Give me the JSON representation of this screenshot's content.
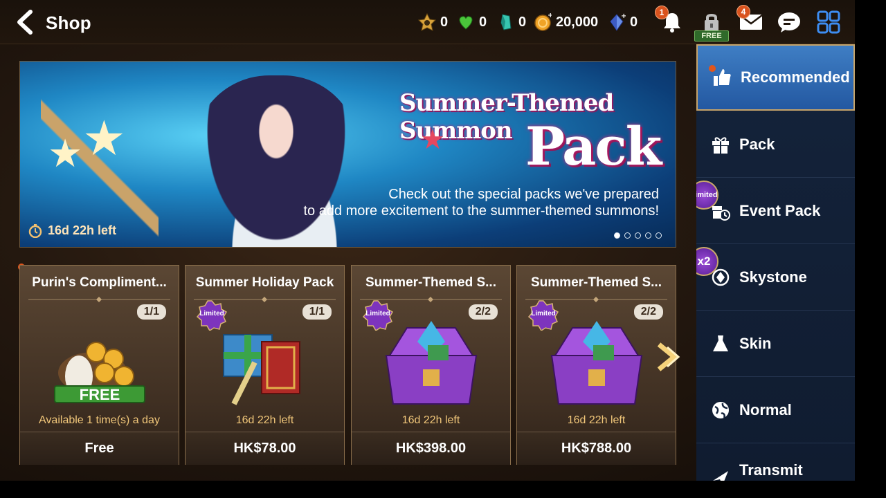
{
  "header": {
    "title": "Shop",
    "currencies": [
      {
        "icon": "mystic-medal-icon",
        "value": "0"
      },
      {
        "icon": "friendship-heart-icon",
        "value": "0"
      },
      {
        "icon": "molagora-crystal-icon",
        "value": "0"
      },
      {
        "icon": "gold-coin-icon",
        "value": "20,000"
      },
      {
        "icon": "skystone-icon",
        "value": "0"
      }
    ],
    "notification_count": "1",
    "mail_count": "4",
    "free_label": "FREE"
  },
  "banner": {
    "title_line1": "Summer-Themed Summon",
    "title_line2": "Pack",
    "description_line1": "Check out the special packs we've prepared",
    "description_line2": "to add more excitement to the summer-themed summons!",
    "timer": "16d 22h left",
    "page_index": 0,
    "page_count": 5
  },
  "cards": [
    {
      "title": "Purin's Compliment...",
      "count": "1/1",
      "limited": false,
      "free_tag": "FREE",
      "note": "Available 1 time(s) a day",
      "price": "Free",
      "has_new_dot": true
    },
    {
      "title": "Summer Holiday Pack",
      "count": "1/1",
      "limited": true,
      "note": "16d 22h left",
      "price": "HK$78.00"
    },
    {
      "title": "Summer-Themed S...",
      "count": "2/2",
      "limited": true,
      "note": "16d 22h left",
      "price": "HK$398.00"
    },
    {
      "title": "Summer-Themed S...",
      "count": "2/2",
      "limited": true,
      "note": "16d 22h left",
      "price": "HK$788.00"
    }
  ],
  "limited_label": "Limited",
  "side_menu": [
    {
      "label": "Recommended",
      "icon": "thumbs-up-icon",
      "active": true,
      "badge": ""
    },
    {
      "label": "Pack",
      "icon": "gift-icon",
      "active": false,
      "badge": ""
    },
    {
      "label": "Event Pack",
      "icon": "event-gift-icon",
      "active": false,
      "badge": "Limited"
    },
    {
      "label": "Skystone",
      "icon": "skystone-icon",
      "active": false,
      "badge": "x2"
    },
    {
      "label": "Skin",
      "icon": "dress-icon",
      "active": false,
      "badge": ""
    },
    {
      "label": "Normal",
      "icon": "globe-icon",
      "active": false,
      "badge": ""
    },
    {
      "label": "Transmit",
      "icon": "transmit-icon",
      "active": false,
      "badge": ""
    }
  ],
  "colors": {
    "accent_gold": "#f1c77a",
    "badge_orange": "#e0561d",
    "menu_active": "#2f6bb3",
    "limited_purple": "#7d34bd"
  }
}
